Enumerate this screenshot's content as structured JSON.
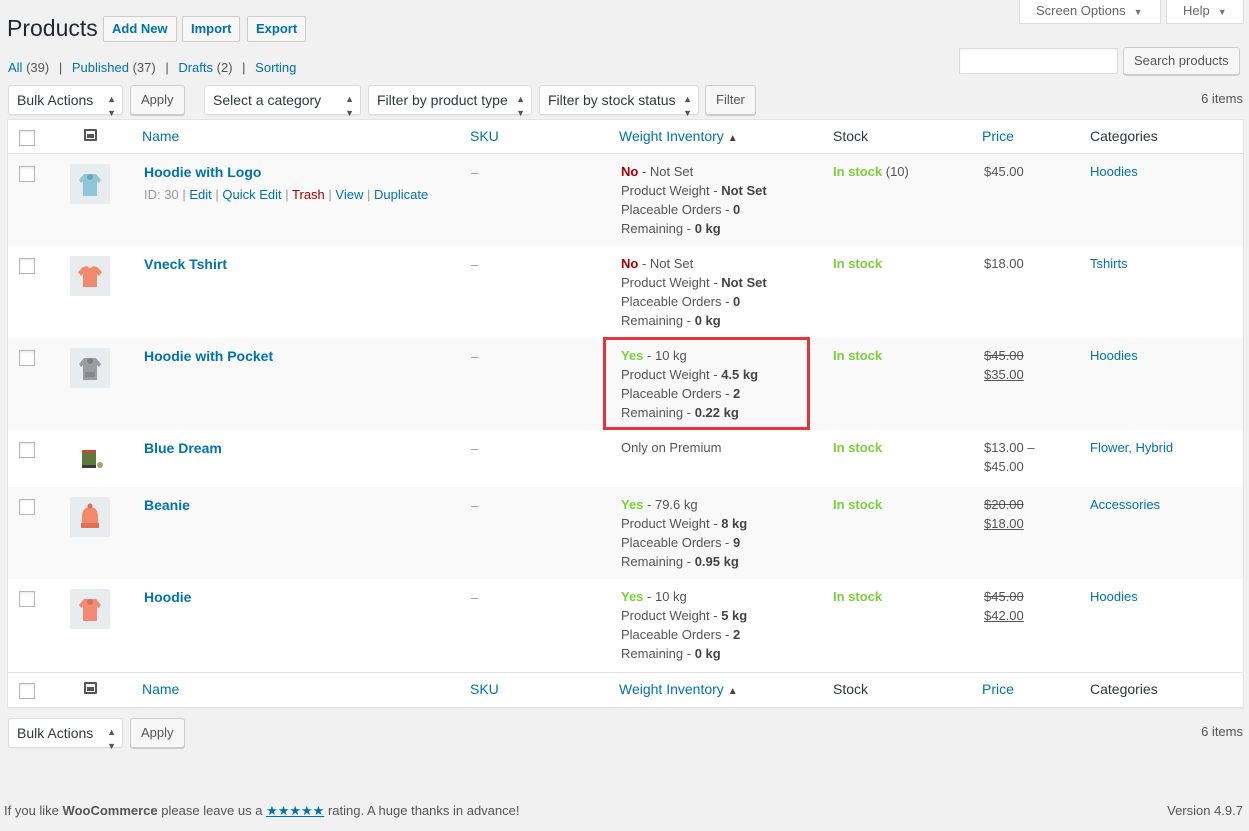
{
  "header": {
    "title": "Products",
    "buttons": {
      "add_new": "Add New",
      "import": "Import",
      "export": "Export"
    },
    "screen_options": "Screen Options",
    "help": "Help"
  },
  "views": {
    "all": "All",
    "all_count": "(39)",
    "published": "Published",
    "published_count": "(37)",
    "drafts": "Drafts",
    "drafts_count": "(2)",
    "sorting": "Sorting",
    "sep": "|"
  },
  "search": {
    "value": "",
    "button": "Search products"
  },
  "filters": {
    "bulk_actions": "Bulk Actions",
    "apply": "Apply",
    "category": "Select a category",
    "product_type": "Filter by product type",
    "stock_status": "Filter by stock status",
    "filter_button": "Filter"
  },
  "items_count": "6 items",
  "columns": {
    "name": "Name",
    "sku": "SKU",
    "weight_inventory": "Weight Inventory",
    "sort_indicator": "▲",
    "stock": "Stock",
    "price": "Price",
    "categories": "Categories"
  },
  "rows": [
    {
      "name": "Hoodie with Logo",
      "actions": {
        "id": "ID: 30",
        "sep": "|",
        "edit": "Edit",
        "quick_edit": "Quick Edit",
        "trash": "Trash",
        "view": "View",
        "duplicate": "Duplicate"
      },
      "sku": "–",
      "wi_flag": "No",
      "wi_flag_rest": " - Not Set",
      "wi_weight_label": "Product Weight - ",
      "wi_weight": "Not Set",
      "wi_orders_label": "Placeable Orders - ",
      "wi_orders": "0",
      "wi_remaining_label": "Remaining - ",
      "wi_remaining": "0 kg",
      "stock": "In stock",
      "stock_qty": " (10)",
      "price": "$45.00",
      "category": "Hoodies",
      "thumb_color": "#8fc6d8"
    },
    {
      "name": "Vneck Tshirt",
      "sku": "–",
      "wi_flag": "No",
      "wi_flag_rest": " - Not Set",
      "wi_weight_label": "Product Weight - ",
      "wi_weight": "Not Set",
      "wi_orders_label": "Placeable Orders - ",
      "wi_orders": "0",
      "wi_remaining_label": "Remaining - ",
      "wi_remaining": "0 kg",
      "stock": "In stock",
      "price": "$18.00",
      "category": "Tshirts",
      "thumb_color": "#f08a6e"
    },
    {
      "name": "Hoodie with Pocket",
      "sku": "–",
      "wi_flag": "Yes",
      "wi_flag_rest": " - 10 kg",
      "wi_weight_label": "Product Weight - ",
      "wi_weight": "4.5 kg",
      "wi_orders_label": "Placeable Orders - ",
      "wi_orders": "2",
      "wi_remaining_label": "Remaining - ",
      "wi_remaining": "0.22 kg",
      "stock": "In stock",
      "price_old": "$45.00",
      "price_new": "$35.00",
      "category": "Hoodies",
      "thumb_color": "#9a9ea3"
    },
    {
      "name": "Blue Dream",
      "sku": "–",
      "wi_note": "Only on Premium",
      "stock": "In stock",
      "price_range_1": "$13.00 –",
      "price_range_2": "$45.00",
      "category_1": "Flower",
      "category_sep": ", ",
      "category_2": "Hybrid",
      "thumb_color": "#5b7a3c"
    },
    {
      "name": "Beanie",
      "sku": "–",
      "wi_flag": "Yes",
      "wi_flag_rest": " - 79.6 kg",
      "wi_weight_label": "Product Weight - ",
      "wi_weight": "8 kg",
      "wi_orders_label": "Placeable Orders - ",
      "wi_orders": "9",
      "wi_remaining_label": "Remaining - ",
      "wi_remaining": "0.95 kg",
      "stock": "In stock",
      "price_old": "$20.00",
      "price_new": "$18.00",
      "category": "Accessories",
      "thumb_color": "#f3886b"
    },
    {
      "name": "Hoodie",
      "sku": "–",
      "wi_flag": "Yes",
      "wi_flag_rest": " - 10 kg",
      "wi_weight_label": "Product Weight - ",
      "wi_weight": "5 kg",
      "wi_orders_label": "Placeable Orders - ",
      "wi_orders": "2",
      "wi_remaining_label": "Remaining - ",
      "wi_remaining": "0 kg",
      "stock": "In stock",
      "price_old": "$45.00",
      "price_new": "$42.00",
      "category": "Hoodies",
      "thumb_color": "#f38a72"
    }
  ],
  "footer": {
    "left_prefix": "If you like ",
    "brand": "WooCommerce",
    "left_mid": " please leave us a ",
    "stars": "★★★★★",
    "left_suffix": " rating. A huge thanks in advance!",
    "version": "Version 4.9.7"
  },
  "colors": {
    "link": "#0073aa",
    "in_stock": "#7ad03a",
    "no": "#aa0000",
    "highlight": "#e8333b"
  }
}
